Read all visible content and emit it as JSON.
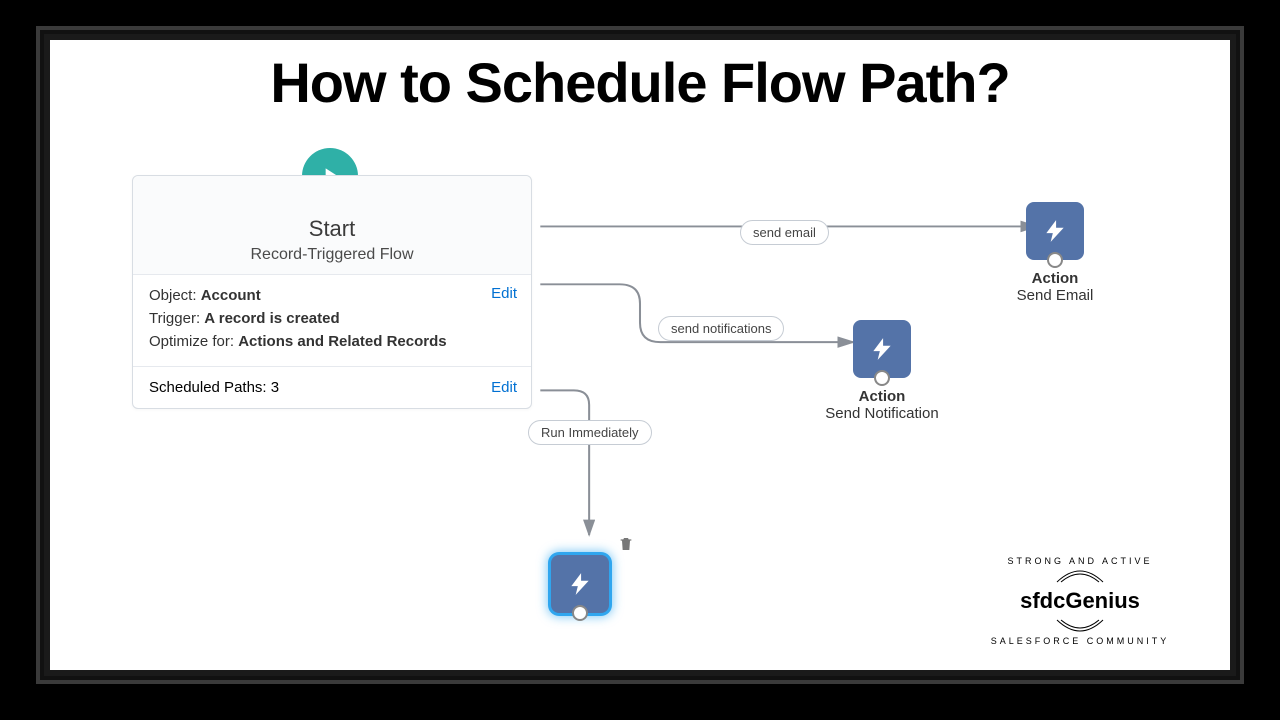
{
  "title": "How to Schedule Flow Path?",
  "start": {
    "heading": "Start",
    "subheading": "Record-Triggered Flow",
    "object_label": "Object:",
    "object_value": "Account",
    "trigger_label": "Trigger:",
    "trigger_value": "A record is created",
    "optimize_label": "Optimize for:",
    "optimize_value": "Actions and Related Records",
    "edit_label": "Edit",
    "scheduled_label": "Scheduled Paths:",
    "scheduled_count": "3",
    "edit_label2": "Edit"
  },
  "paths": {
    "email": "send email",
    "notifications": "send notifications",
    "immediate": "Run Immediately"
  },
  "actions": {
    "label": "Action",
    "email": "Send Email",
    "notification": "Send Notification"
  },
  "logo": {
    "top_arc": "STRONG AND ACTIVE",
    "brand": "sfdcGenius",
    "bottom_arc": "SALESFORCE COMMUNITY"
  }
}
